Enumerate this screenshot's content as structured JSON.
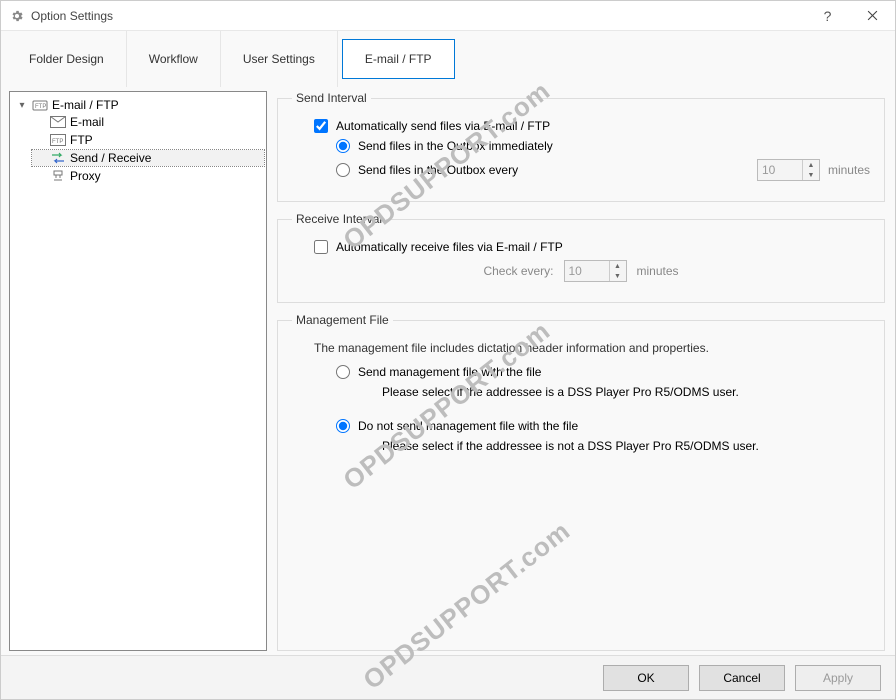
{
  "window": {
    "title": "Option Settings"
  },
  "tabs": {
    "0": "Folder Design",
    "1": "Workflow",
    "2": "User Settings",
    "3": "E-mail / FTP"
  },
  "tree": {
    "root": "E-mail / FTP",
    "email": "E-mail",
    "ftp": "FTP",
    "sendreceive": "Send / Receive",
    "proxy": "Proxy"
  },
  "send": {
    "legend": "Send Interval",
    "auto": "Automatically send files via E-mail / FTP",
    "opt_immediate": "Send files in the Outbox immediately",
    "opt_every": "Send files in the Outbox every",
    "every_value": "10",
    "every_unit": "minutes"
  },
  "receive": {
    "legend": "Receive Interval",
    "auto": "Automatically receive files via E-mail / FTP",
    "check_label": "Check every:",
    "check_value": "10",
    "check_unit": "minutes"
  },
  "mgmt": {
    "legend": "Management File",
    "desc": "The management file includes dictation header information and properties.",
    "opt_send": "Send management file with the file",
    "opt_send_note": "Please select if the addressee is a DSS Player Pro R5/ODMS user.",
    "opt_nosend": "Do not send management file with the file",
    "opt_nosend_note": "Please select if the addressee is not a DSS Player Pro R5/ODMS user."
  },
  "buttons": {
    "ok": "OK",
    "cancel": "Cancel",
    "apply": "Apply"
  },
  "watermark": "OPDSUPPORT.com"
}
